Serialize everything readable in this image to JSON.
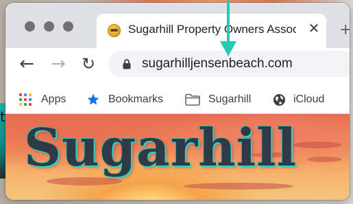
{
  "desktop": {
    "left_fragment": "t"
  },
  "tab": {
    "title": "Sugarhill Property Owners Assoc",
    "close_label": "✕",
    "new_tab_label": "+"
  },
  "toolbar": {
    "back": "←",
    "forward": "→",
    "reload": "↻",
    "url": "sugarhilljensenbeach.com"
  },
  "bookmarks": [
    {
      "label": "Apps",
      "icon": "apps-grid-icon"
    },
    {
      "label": "Bookmarks",
      "icon": "star-icon"
    },
    {
      "label": "Sugarhill",
      "icon": "folder-icon"
    },
    {
      "label": "iCloud",
      "icon": "globe-icon"
    }
  ],
  "page": {
    "hero_title": "Sugarhill"
  },
  "colors": {
    "annotation_arrow": "#22cbb0",
    "tab_strip": "#dee1e6",
    "omnibox": "#f1f3f4",
    "bookmark_star": "#1a73e8",
    "hero_text": "#2e3a46",
    "hero_outline": "#2fd2c8"
  }
}
